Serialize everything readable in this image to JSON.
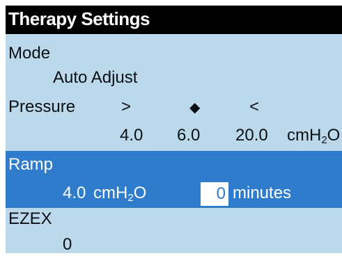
{
  "screen": {
    "title": "Therapy Settings",
    "mode": {
      "label": "Mode",
      "value": "Auto Adjust"
    },
    "pressure": {
      "label": "Pressure",
      "min_symbol": ">",
      "set_symbol": "◆",
      "max_symbol": "<",
      "min_value": "4.0",
      "set_value": "6.0",
      "max_value": "20.0",
      "unit_main": "cmH",
      "unit_sub": "2",
      "unit_end": "O"
    },
    "ramp": {
      "label": "Ramp",
      "pressure_value": "4.0",
      "unit_main": "cmH",
      "unit_sub": "2",
      "unit_end": "O",
      "minutes_value": "0",
      "minutes_label": "minutes"
    },
    "ezex": {
      "label": "EZEX",
      "value": "0"
    }
  },
  "colors": {
    "background": "#bcd9ec",
    "title_bar": "#000000",
    "highlight": "#2e7ccb",
    "text": "#0a0f14"
  }
}
